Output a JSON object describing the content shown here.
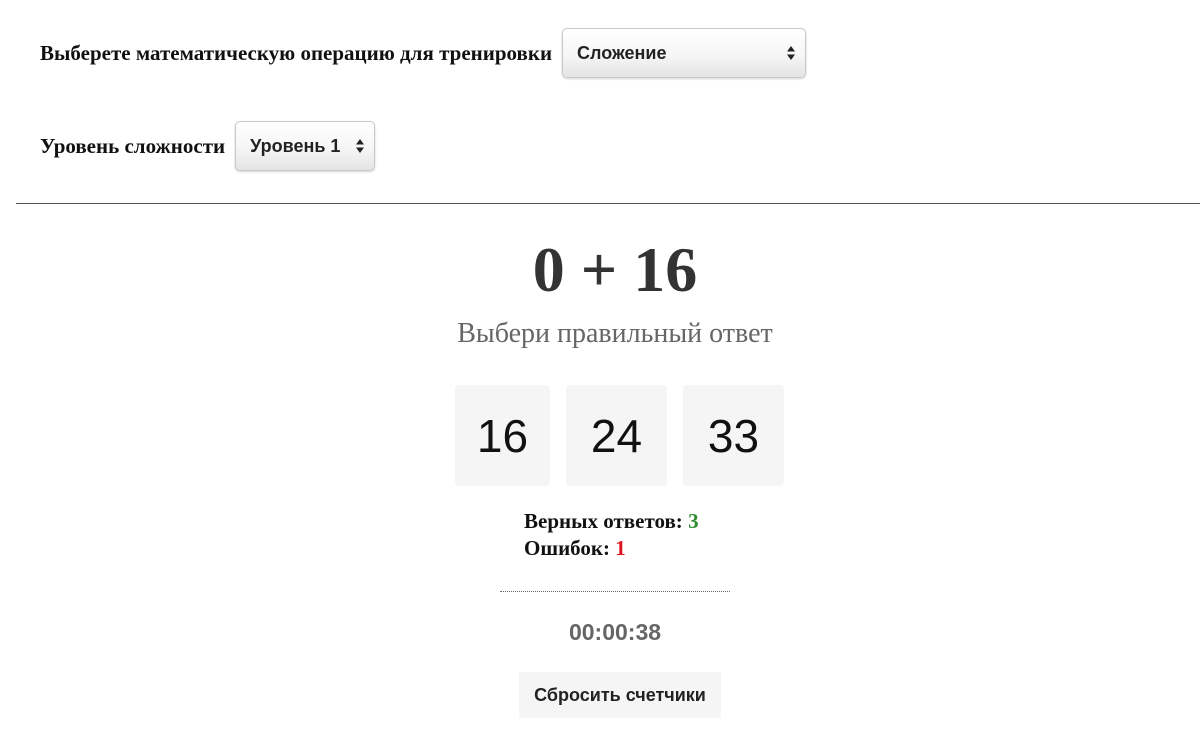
{
  "operation": {
    "label": "Выберете математическую операцию для тренировки",
    "selected": "Сложение"
  },
  "level": {
    "label": "Уровень сложности",
    "selected": "Уровень 1"
  },
  "task": {
    "expression": "0 + 16",
    "prompt": "Выбери правильный ответ"
  },
  "answers": [
    "16",
    "24",
    "33"
  ],
  "stats": {
    "correct_label": "Верных ответов:",
    "correct_value": "3",
    "errors_label": "Ошибок:",
    "errors_value": "1"
  },
  "timer": "00:00:38",
  "reset_button": "Сбросить счетчики",
  "colors": {
    "correct": "#2e8b2e",
    "errors": "#e0141e",
    "answer_bg": "#f5f5f5"
  },
  "icons": {
    "select_arrows": "up-down-arrows-icon"
  }
}
